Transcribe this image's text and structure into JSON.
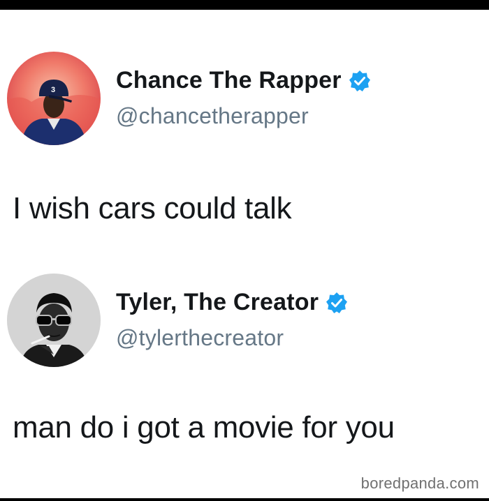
{
  "tweets": [
    {
      "display_name": "Chance The Rapper",
      "handle": "@chancetherapper",
      "text": "I wish cars could talk",
      "avatar_icon": "chance-avatar",
      "avatar_cap_number": "3"
    },
    {
      "display_name": "Tyler, The Creator",
      "handle": "@tylerthecreator",
      "text": "man do i got a movie for you",
      "avatar_icon": "tyler-avatar"
    }
  ],
  "watermark": "boredpanda.com",
  "colors": {
    "verified_blue": "#1da1f2",
    "handle_gray": "#657786",
    "text": "#14171a"
  }
}
